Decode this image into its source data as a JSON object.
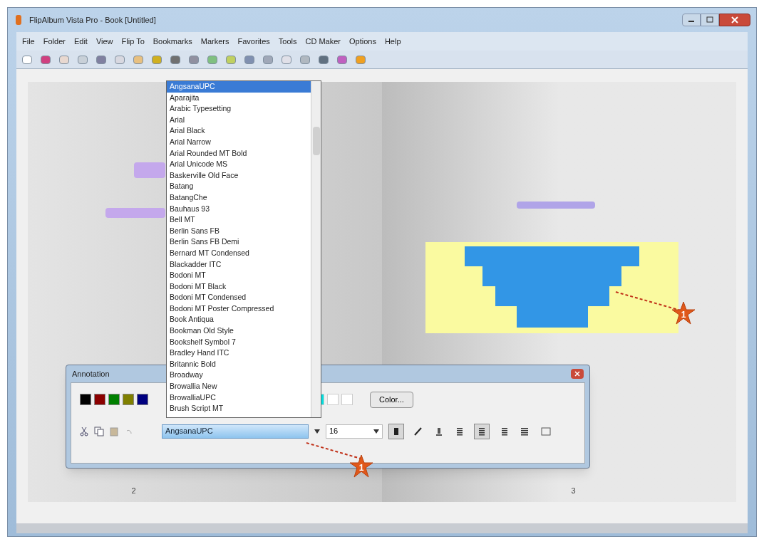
{
  "window": {
    "title": "FlipAlbum Vista Pro - Book [Untitled]"
  },
  "menu": [
    "File",
    "Folder",
    "Edit",
    "View",
    "Flip To",
    "Bookmarks",
    "Markers",
    "Favorites",
    "Tools",
    "CD Maker",
    "Options",
    "Help"
  ],
  "left_page": {
    "page_number": "2"
  },
  "right_page": {
    "page_number": "3"
  },
  "callouts": [
    {
      "number": "1"
    },
    {
      "number": "1"
    }
  ],
  "annotation": {
    "title": "Annotation",
    "swatches": [
      {
        "color": "#000000"
      },
      {
        "color": "#8b0000"
      },
      {
        "color": "#008000"
      },
      {
        "color": "#808000"
      },
      {
        "color": "#000080"
      }
    ],
    "swatches_right": [
      {
        "color": "#00e0e0"
      },
      {
        "color": "#ffffff"
      },
      {
        "color": "#ffffff"
      }
    ],
    "color_button": "Color...",
    "font": "AngsanaUPC",
    "size": "16",
    "format_buttons": [
      {
        "kind": "bold",
        "selected": true
      },
      {
        "kind": "pen",
        "selected": false
      },
      {
        "kind": "underline",
        "selected": false
      },
      {
        "kind": "left",
        "selected": false
      },
      {
        "kind": "center",
        "selected": true
      },
      {
        "kind": "right",
        "selected": false
      },
      {
        "kind": "justify",
        "selected": false
      },
      {
        "kind": "frame",
        "selected": false
      }
    ]
  },
  "font_list": [
    {
      "label": "AngsanaUPC",
      "selected": true
    },
    {
      "label": "Aparajita",
      "selected": false
    },
    {
      "label": "Arabic Typesetting",
      "selected": false
    },
    {
      "label": "Arial",
      "selected": false
    },
    {
      "label": "Arial Black",
      "selected": false
    },
    {
      "label": "Arial Narrow",
      "selected": false
    },
    {
      "label": "Arial Rounded MT Bold",
      "selected": false
    },
    {
      "label": "Arial Unicode MS",
      "selected": false
    },
    {
      "label": "Baskerville Old Face",
      "selected": false
    },
    {
      "label": "Batang",
      "selected": false
    },
    {
      "label": "BatangChe",
      "selected": false
    },
    {
      "label": "Bauhaus 93",
      "selected": false
    },
    {
      "label": "Bell MT",
      "selected": false
    },
    {
      "label": "Berlin Sans FB",
      "selected": false
    },
    {
      "label": "Berlin Sans FB Demi",
      "selected": false
    },
    {
      "label": "Bernard MT Condensed",
      "selected": false
    },
    {
      "label": "Blackadder ITC",
      "selected": false
    },
    {
      "label": "Bodoni MT",
      "selected": false
    },
    {
      "label": "Bodoni MT Black",
      "selected": false
    },
    {
      "label": "Bodoni MT Condensed",
      "selected": false
    },
    {
      "label": "Bodoni MT Poster Compressed",
      "selected": false
    },
    {
      "label": "Book Antiqua",
      "selected": false
    },
    {
      "label": "Bookman Old Style",
      "selected": false
    },
    {
      "label": "Bookshelf Symbol 7",
      "selected": false
    },
    {
      "label": "Bradley Hand ITC",
      "selected": false
    },
    {
      "label": "Britannic Bold",
      "selected": false
    },
    {
      "label": "Broadway",
      "selected": false
    },
    {
      "label": "Browallia New",
      "selected": false
    },
    {
      "label": "BrowalliaUPC",
      "selected": false
    },
    {
      "label": "Brush Script MT",
      "selected": false
    }
  ]
}
